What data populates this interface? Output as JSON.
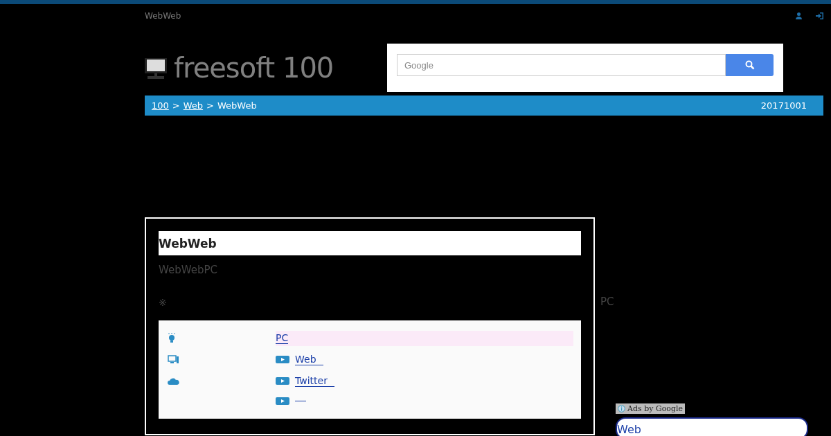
{
  "header": {
    "site_title": "WebWeb"
  },
  "logo": {
    "text": "freesoft 100"
  },
  "search": {
    "placeholder": "Google"
  },
  "breadcrumb": {
    "items": [
      {
        "text": "100",
        "kind": "link"
      },
      {
        "text": "Web",
        "kind": "link"
      },
      {
        "text": "WebWeb",
        "kind": "current"
      }
    ],
    "separator": ">",
    "date": "20171001"
  },
  "article": {
    "title": "WebWeb",
    "subtitle": "WebWebPC",
    "note": "※",
    "rows": [
      {
        "kind": "highlight",
        "text": "PC"
      },
      {
        "kind": "play",
        "text": "Web"
      },
      {
        "kind": "play",
        "text": "Twitter"
      },
      {
        "kind": "blank"
      }
    ]
  },
  "side": {
    "text": "PC"
  },
  "ad": {
    "label": "Ads by Google",
    "link": "Web"
  }
}
